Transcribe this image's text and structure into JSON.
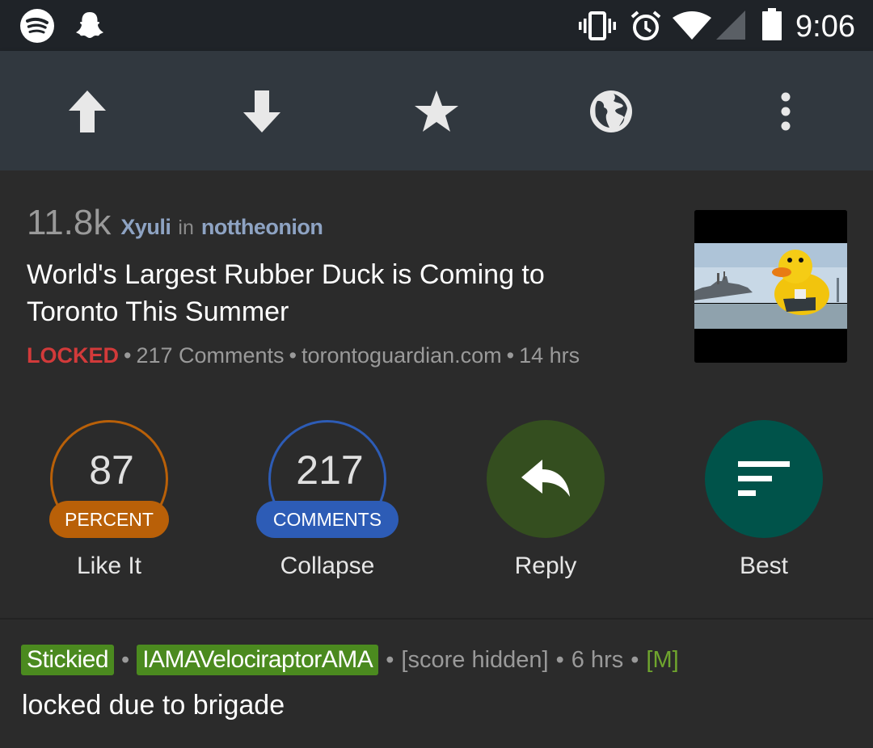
{
  "status_bar": {
    "time": "9:06",
    "icons": [
      "spotify-icon",
      "snapchat-icon",
      "vibrate-icon",
      "alarm-icon",
      "wifi-icon",
      "signal-icon",
      "battery-icon"
    ]
  },
  "toolbar": {
    "buttons": [
      "upvote",
      "downvote",
      "save",
      "open-browser",
      "more"
    ]
  },
  "post": {
    "score": "11.8k",
    "author": "Xyuli",
    "in_word": "in",
    "subreddit": "nottheonion",
    "title": "World's Largest Rubber Duck is Coming to Toronto This Summer",
    "locked_label": "LOCKED",
    "comments_text": "217 Comments",
    "domain": "torontoguardian.com",
    "age": "14 hrs",
    "separator": "•"
  },
  "actions": {
    "like": {
      "number": "87",
      "pill": "PERCENT",
      "label": "Like It",
      "color": "#b96008"
    },
    "collapse": {
      "number": "217",
      "pill": "COMMENTS",
      "label": "Collapse",
      "color": "#2d5cb6"
    },
    "reply": {
      "label": "Reply",
      "color": "#344e1f"
    },
    "best": {
      "label": "Best",
      "color": "#00534a"
    }
  },
  "comment": {
    "stickied_label": "Stickied",
    "author": "IAMAVelociraptorAMA",
    "score": "[score hidden]",
    "age": "6 hrs",
    "mod_tag": "[M]",
    "separator": "•",
    "body": "locked due to brigade"
  }
}
